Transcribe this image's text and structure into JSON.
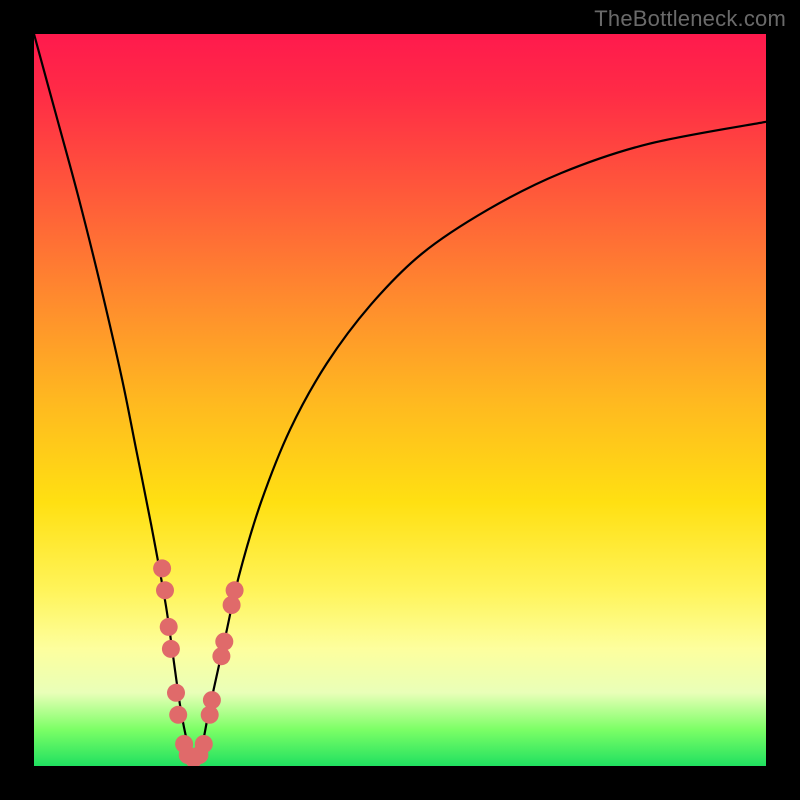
{
  "watermark": "TheBottleneck.com",
  "chart_data": {
    "type": "line",
    "title": "",
    "xlabel": "",
    "ylabel": "",
    "xlim": [
      0,
      100
    ],
    "ylim": [
      0,
      100
    ],
    "series": [
      {
        "name": "bottleneck-curve",
        "x": [
          0,
          3,
          6,
          9,
          12,
          14,
          16,
          18,
          19,
          20,
          21,
          22,
          23,
          24,
          26,
          28,
          31,
          35,
          40,
          46,
          53,
          62,
          72,
          84,
          100
        ],
        "y": [
          100,
          89,
          78,
          66,
          53,
          43,
          33,
          22,
          15,
          8,
          3,
          0,
          3,
          8,
          17,
          26,
          36,
          46,
          55,
          63,
          70,
          76,
          81,
          85,
          88
        ]
      }
    ],
    "markers": {
      "name": "highlight-dots",
      "color": "#e06a6a",
      "points": [
        {
          "x": 17.5,
          "y": 27
        },
        {
          "x": 17.9,
          "y": 24
        },
        {
          "x": 18.4,
          "y": 19
        },
        {
          "x": 18.7,
          "y": 16
        },
        {
          "x": 19.4,
          "y": 10
        },
        {
          "x": 19.7,
          "y": 7
        },
        {
          "x": 20.5,
          "y": 3
        },
        {
          "x": 21.0,
          "y": 1.5
        },
        {
          "x": 21.8,
          "y": 1
        },
        {
          "x": 22.6,
          "y": 1.5
        },
        {
          "x": 23.2,
          "y": 3
        },
        {
          "x": 24.0,
          "y": 7
        },
        {
          "x": 24.3,
          "y": 9
        },
        {
          "x": 25.6,
          "y": 15
        },
        {
          "x": 26.0,
          "y": 17
        },
        {
          "x": 27.0,
          "y": 22
        },
        {
          "x": 27.4,
          "y": 24
        }
      ]
    },
    "gradient_stops": [
      {
        "pos": 0,
        "color": "#ff1a4d"
      },
      {
        "pos": 50,
        "color": "#ffe012"
      },
      {
        "pos": 100,
        "color": "#20e060"
      }
    ]
  }
}
